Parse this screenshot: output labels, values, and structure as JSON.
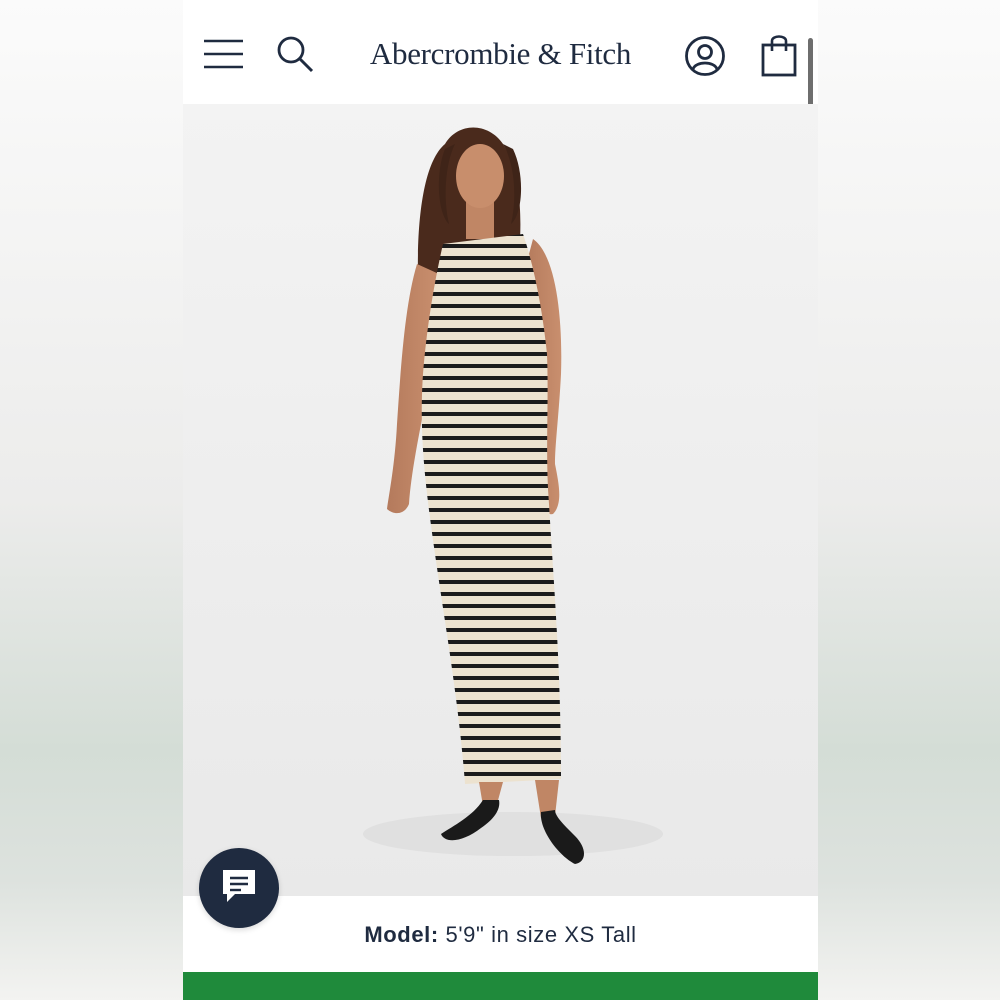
{
  "header": {
    "brand_name": "Abercrombie & Fitch",
    "menu_icon": "hamburger-menu-icon",
    "search_icon": "search-icon",
    "account_icon": "account-icon",
    "bag_icon": "shopping-bag-icon"
  },
  "product": {
    "image_description_icon": "product-photo",
    "model_label": "Model:",
    "model_value": "5'9\" in size XS Tall"
  },
  "chat": {
    "icon": "chat-icon"
  },
  "colors": {
    "brand_navy": "#1f2b40",
    "bottom_bar_green": "#1f8a3b",
    "stripe_cream": "#ece2cf",
    "stripe_black": "#1b1b1b"
  }
}
